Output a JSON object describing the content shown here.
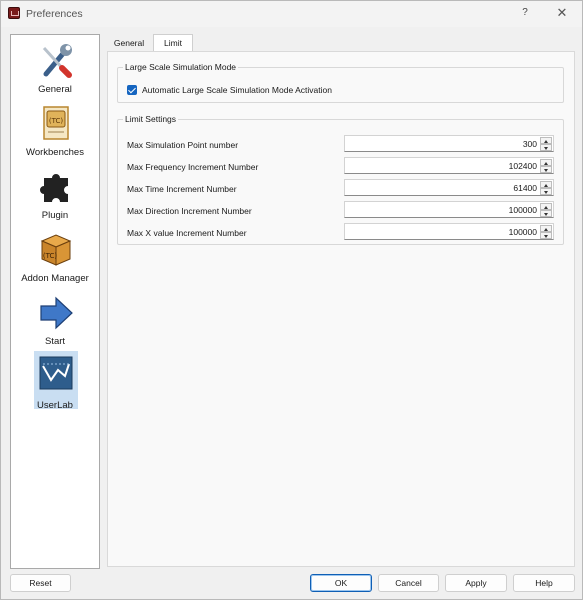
{
  "window": {
    "title": "Preferences",
    "help_glyph": "?",
    "close_glyph": "✕"
  },
  "sidebar": {
    "items": [
      {
        "label": "General",
        "icon": "wrench-screwdriver-icon"
      },
      {
        "label": "Workbenches",
        "icon": "document-icon"
      },
      {
        "label": "Plugin",
        "icon": "puzzle-icon"
      },
      {
        "label": "Addon Manager",
        "icon": "package-box-icon"
      },
      {
        "label": "Start",
        "icon": "arrow-right-icon"
      },
      {
        "label": "UserLab",
        "icon": "userlab-chart-icon",
        "selected": true
      }
    ]
  },
  "tabs": [
    {
      "label": "General"
    },
    {
      "label": "Limit",
      "active": true
    }
  ],
  "large_scale": {
    "title": "Large Scale Simulation Mode",
    "checkbox_label": "Automatic Large Scale Simulation Mode Activation",
    "checked": true
  },
  "limit_settings": {
    "title": "Limit Settings",
    "rows": [
      {
        "label": "Max Simulation Point number",
        "value": "300"
      },
      {
        "label": "Max Frequency Increment Number",
        "value": "102400"
      },
      {
        "label": "Max Time Increment Number",
        "value": "61400"
      },
      {
        "label": "Max Direction Increment Number",
        "value": "100000"
      },
      {
        "label": "Max X value Increment Number",
        "value": "100000"
      }
    ]
  },
  "buttons": {
    "reset": "Reset",
    "ok": "OK",
    "cancel": "Cancel",
    "apply": "Apply",
    "help": "Help"
  },
  "colors": {
    "accent": "#1565c0",
    "selection": "#c9def2"
  }
}
